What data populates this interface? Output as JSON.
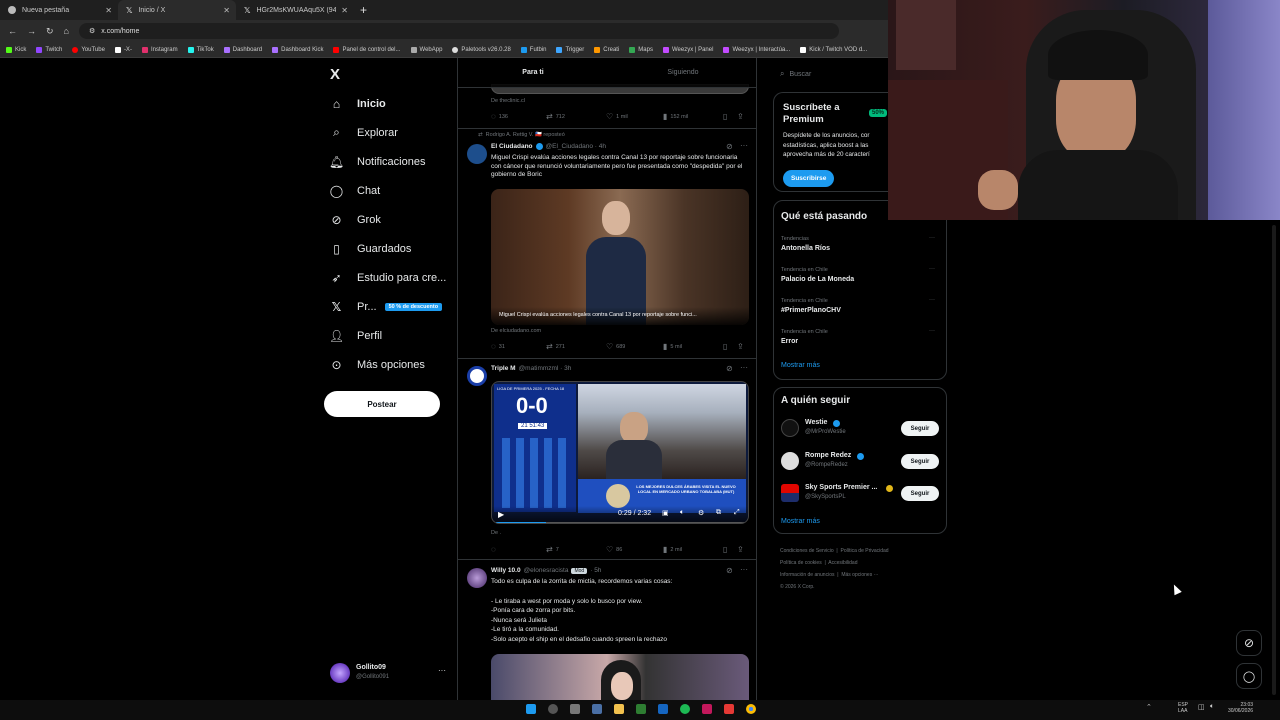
{
  "browser": {
    "tabs": [
      {
        "title": "Nueva pestaña",
        "active": false
      },
      {
        "title": "Inicio / X",
        "active": true
      },
      {
        "title": "HGr2MsKWUAAqu5X (941×16…",
        "active": false
      }
    ],
    "url": "x.com/home",
    "bookmarks": [
      "Kick",
      "Twitch",
      "YouTube",
      "-X-",
      "Instagram",
      "TikTok",
      "Dashboard",
      "Dashboard Kick",
      "Panel de control del...",
      "WebApp",
      "Paletools v26.0.28",
      "Futbin",
      "Trigger",
      "Creati",
      "Maps",
      "Weezyx | Panel",
      "Weezyx | Interactúa...",
      "Kick / Twitch VOD d..."
    ]
  },
  "nav": {
    "logo": "X",
    "items": [
      "Inicio",
      "Explorar",
      "Notificaciones",
      "Chat",
      "Grok",
      "Guardados",
      "Estudio para cre...",
      "Pr...",
      "Perfil",
      "Más opciones"
    ],
    "premium_badge": "50 % de descuento",
    "post_label": "Postear",
    "account_name": "Gollito09",
    "account_handle": "@Gollito091"
  },
  "feed": {
    "tabs": [
      "Para ti",
      "Siguiendo"
    ],
    "top_tweet": {
      "source": "De theclinic.cl",
      "stats": [
        "136",
        "712",
        "1 mil",
        "152 mil"
      ]
    },
    "tweet1": {
      "repost": "Rodrigo A. Rettig V. 🇨🇱 reposteó",
      "name": "El Ciudadano",
      "handle": "@El_Ciudadano · 4h",
      "text": "Miguel Crispi evalúa acciones legales contra Canal 13 por reportaje sobre funcionaria con cáncer que renunció voluntariamente pero fue presentada como \"despedida\" por el gobierno de Boric",
      "image_caption": "Miguel Crispi evalúa acciones legales contra Canal 13 por reportaje sobre funci...",
      "source": "De elciudadano.com",
      "stats": [
        "31",
        "271",
        "689",
        "5 mil"
      ]
    },
    "tweet2": {
      "name": "Triple M",
      "handle": "@matimmzml · 3h",
      "video_time": "0:29 / 2:32",
      "score": "0-0",
      "scoreboard_header": "LIGA DE PRIMERA 2025 - FECHA 18",
      "clock": "21 51:43",
      "ad_text": "LOS MEJORES DULCES ÁRABES VISITA EL NUEVO LOCAL EN MERCADO URBANO TOBALABA (MUT)",
      "source": "De .",
      "stats": [
        "",
        "7",
        "86",
        "2 mil"
      ]
    },
    "tweet3": {
      "name": "Willy 10.0",
      "handle": "@elonesracista",
      "tag": "Mod",
      "time": "· 5h",
      "lines": [
        "Todo es culpa de la zorrita de mictia, recordemos varias cosas:",
        "",
        "- Le tiraba a west por moda y solo lo busco por view.",
        "-Ponía cara de zorra por bits.",
        "-Nunca será Julieta",
        "-Le tiró a la comunidad.",
        "-Solo acepto el ship en el dedsafio cuando spreen la rechazo"
      ]
    }
  },
  "sidebar": {
    "search_placeholder": "Buscar",
    "premium": {
      "title": "Suscríbete a Premium",
      "badge": "50%",
      "text": [
        "Despídete de los anuncios, cor",
        "estadísticas, aplica boost a las",
        "aprovecha más de 20 caracterí"
      ],
      "button": "Suscribirse"
    },
    "trends": {
      "title": "Qué está pasando",
      "items": [
        {
          "meta": "Tendencias",
          "name": "Antonella Ríos"
        },
        {
          "meta": "Tendencia en Chile",
          "name": "Palacio de La Moneda"
        },
        {
          "meta": "Tendencia en Chile",
          "name": "#PrimerPlanoCHV"
        },
        {
          "meta": "Tendencia en Chile",
          "name": "Error"
        }
      ],
      "more": "Mostrar más"
    },
    "follow": {
      "title": "A quién seguir",
      "items": [
        {
          "name": "Westie",
          "handle": "@MrProWestie",
          "button": "Seguir"
        },
        {
          "name": "Rompe Redez",
          "handle": "@RompeRedez",
          "button": "Seguir"
        },
        {
          "name": "Sky Sports Premier ...",
          "handle": "@SkySportsPL",
          "button": "Seguir"
        }
      ],
      "more": "Mostrar más"
    },
    "footer": [
      "Condiciones de Servicio",
      "Política de Privacidad",
      "Política de cookies",
      "Accesibilidad",
      "Información de anuncios",
      "Más opciones ···",
      "© 2026 X Corp."
    ]
  },
  "taskbar": {
    "lang": "ESP",
    "lang2": "LAA",
    "time": "23:03",
    "date": "30/06/2026"
  },
  "colors": {
    "accent": "#1d9bf0",
    "premium_green": "#00ba7c",
    "background": "#000000",
    "border": "#2f3336"
  }
}
